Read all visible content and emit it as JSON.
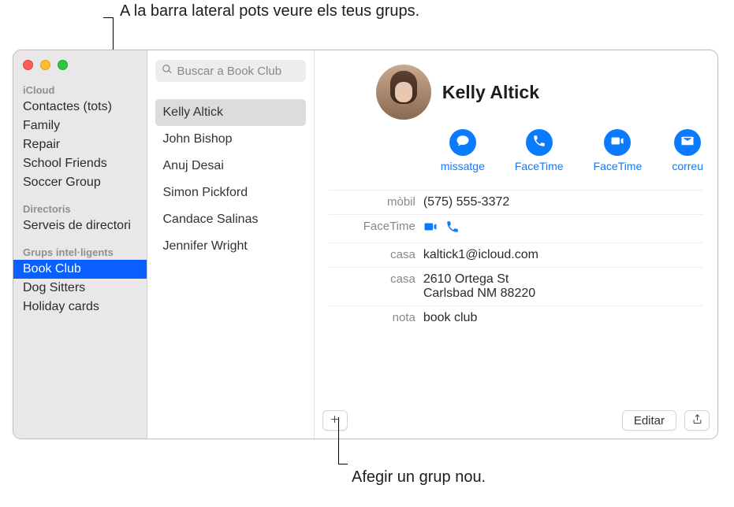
{
  "callouts": {
    "top": "A la barra lateral pots veure els teus grups.",
    "bottom": "Afegir un grup nou."
  },
  "sidebar": {
    "sections": [
      {
        "header": "iCloud",
        "items": [
          "Contactes (tots)",
          "Family",
          "Repair",
          "School Friends",
          "Soccer Group"
        ]
      },
      {
        "header": "Directoris",
        "items": [
          "Serveis de directori"
        ]
      },
      {
        "header": "Grups intel·ligents",
        "items": [
          "Book Club",
          "Dog Sitters",
          "Holiday cards"
        ],
        "selected": "Book Club"
      }
    ]
  },
  "search": {
    "placeholder": "Buscar a Book Club"
  },
  "contacts": {
    "items": [
      "Kelly Altick",
      "John Bishop",
      "Anuj Desai",
      "Simon Pickford",
      "Candace Salinas",
      "Jennifer Wright"
    ],
    "selected": "Kelly Altick"
  },
  "detail": {
    "name": "Kelly Altick",
    "actions": {
      "message": "missatge",
      "facetime_audio": "FaceTime",
      "facetime_video": "FaceTime",
      "mail": "correu"
    },
    "fields": {
      "mobile": {
        "label": "mòbil",
        "value": "(575) 555-3372"
      },
      "facetime": {
        "label": "FaceTime"
      },
      "home_email": {
        "label": "casa",
        "value": "kaltick1@icloud.com"
      },
      "home_addr": {
        "label": "casa",
        "value": "2610 Ortega St\nCarlsbad NM 88220"
      },
      "note": {
        "label": "nota",
        "value": "book club"
      }
    },
    "buttons": {
      "edit": "Editar"
    }
  }
}
